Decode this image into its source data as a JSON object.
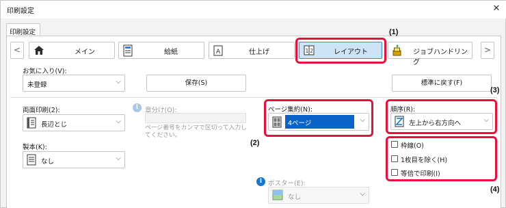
{
  "window": {
    "title": "印刷設定",
    "close_glyph": "✕"
  },
  "tab": {
    "label": "印刷設定"
  },
  "nav": {
    "prev_glyph": "<",
    "next_glyph": ">",
    "items": [
      {
        "label": "メイン",
        "icon": "home-icon"
      },
      {
        "label": "給紙",
        "icon": "paper-tray-icon"
      },
      {
        "label": "仕上げ",
        "icon": "finishing-icon"
      },
      {
        "label": "レイアウト",
        "icon": "layout-icon",
        "selected": true
      },
      {
        "label": "ジョブハンドリング",
        "icon": "job-handling-icon"
      }
    ]
  },
  "favorites": {
    "label": "お気に入り(V):",
    "value": "未登録",
    "save_button": "保存(S)",
    "reset_button": "標準に戻す(F)"
  },
  "duplex": {
    "label": "両面印刷(2):",
    "value": "長辺とじ"
  },
  "binding": {
    "label": "製本(K):",
    "value": "なし"
  },
  "chapter": {
    "label": "章分け(O):",
    "placeholder": "ページ番号をカンマで区切って入力してください。"
  },
  "nup": {
    "label": "ページ集約(N):",
    "value": "4ページ"
  },
  "order": {
    "label": "順序(R):",
    "value": "左上から右方向へ"
  },
  "options": {
    "items": [
      {
        "label": "枠線(O)",
        "checked": false
      },
      {
        "label": "1枚目を除く(H)",
        "checked": false
      },
      {
        "label": "等倍で印刷(I)",
        "checked": false
      }
    ]
  },
  "poster": {
    "label": "ポスター(E):",
    "value": "なし"
  },
  "callouts": {
    "c1": "(1)",
    "c2": "(2)",
    "c3": "(3)",
    "c4": "(4)"
  },
  "colors": {
    "highlight": "#e8103a",
    "selected_bg": "#cde4f7",
    "selected_border": "#3c8ad6",
    "combo_selected": "#0a64c8"
  }
}
